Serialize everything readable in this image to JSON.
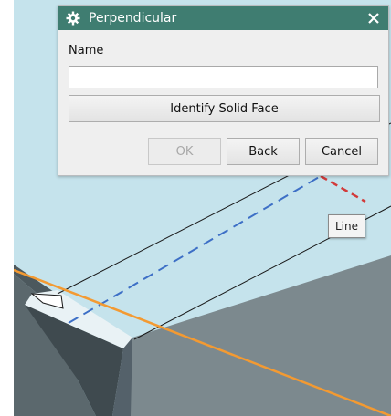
{
  "dialog": {
    "title": "Perpendicular",
    "title_icon": "gear-icon",
    "close_icon": "close-icon",
    "name_label": "Name",
    "name_value": "",
    "identify_button": "Identify Solid Face",
    "ok_button": "OK",
    "back_button": "Back",
    "cancel_button": "Cancel"
  },
  "viewport": {
    "tooltip": "Line",
    "colors": {
      "background": "#c5e3ec",
      "edge_highlight": "#f39a32",
      "perpendicular_line": "#3d6fc6",
      "dimension_line": "#d23a3a",
      "solid_dark": "#5b686d",
      "solid_light": "#7c898e",
      "solid_top": "#e9f2f5"
    }
  },
  "colors": {
    "titlebar": "#3f7d71",
    "dialog_background": "#efefef"
  }
}
